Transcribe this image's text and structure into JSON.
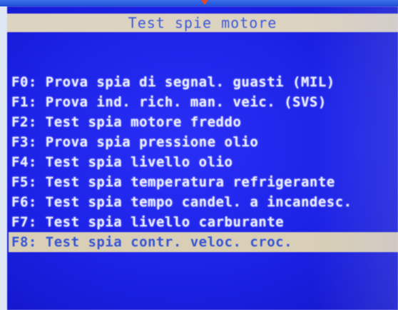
{
  "title": "Test spie motore",
  "menu": [
    {
      "key": "F0:",
      "label": "Prova spia di segnal. guasti (MIL)"
    },
    {
      "key": "F1:",
      "label": "Prova ind. rich. man. veic. (SVS)"
    },
    {
      "key": "F2:",
      "label": "Test spia motore freddo"
    },
    {
      "key": "F3:",
      "label": "Prova spia pressione olio"
    },
    {
      "key": "F4:",
      "label": "Test spia livello olio"
    },
    {
      "key": "F5:",
      "label": "Test spia temperatura refrigerante"
    },
    {
      "key": "F6:",
      "label": "Test spia tempo candel. a incandesc."
    },
    {
      "key": "F7:",
      "label": "Test spia livello carburante"
    },
    {
      "key": "F8:",
      "label": "Test spia contr. veloc. croc."
    }
  ],
  "selected_index": 8,
  "colors": {
    "screen_background": "#1a1fe8",
    "title_bar": "#dcd3c0",
    "highlight": "#d9cfb6",
    "text": "#e9ecff"
  }
}
